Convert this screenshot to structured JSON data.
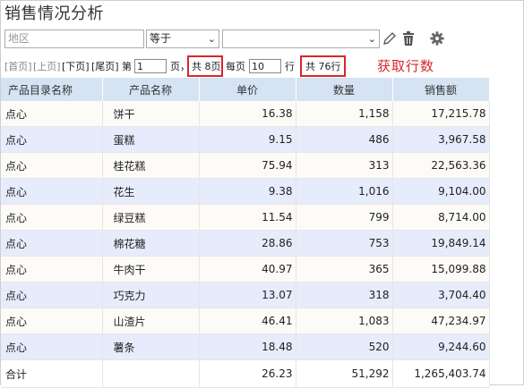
{
  "title": "销售情况分析",
  "filter": {
    "field_placeholder": "地区",
    "operator": "等于",
    "value": ""
  },
  "icons": {
    "edit": "pen-icon",
    "delete": "trash-icon",
    "settings": "gear-icon"
  },
  "pager": {
    "first": "[首页]",
    "prev": "[上页]",
    "next": "[下页]",
    "last": "[尾页]",
    "page_prefix": "第",
    "page_value": "1",
    "page_suffix": "页，",
    "total_pages": "共 8页",
    "per_page_label": "每页",
    "per_page_value": "10",
    "row_unit": "行",
    "total_rows": "共 76行"
  },
  "annotation": "获取行数",
  "colors": {
    "highlight": "#d9262c",
    "header_bg": "#d5e3f3",
    "row_alt": "#e6ecfb"
  },
  "table": {
    "headers": [
      "产品目录名称",
      "产品名称",
      "单价",
      "数量",
      "销售额"
    ],
    "rows": [
      [
        "点心",
        "饼干",
        "16.38",
        "1,158",
        "17,215.78"
      ],
      [
        "点心",
        "蛋糕",
        "9.15",
        "486",
        "3,967.58"
      ],
      [
        "点心",
        "桂花糕",
        "75.94",
        "313",
        "22,563.36"
      ],
      [
        "点心",
        "花生",
        "9.38",
        "1,016",
        "9,104.00"
      ],
      [
        "点心",
        "绿豆糕",
        "11.54",
        "799",
        "8,714.00"
      ],
      [
        "点心",
        "棉花糖",
        "28.86",
        "753",
        "19,849.14"
      ],
      [
        "点心",
        "牛肉干",
        "40.97",
        "365",
        "15,099.88"
      ],
      [
        "点心",
        "巧克力",
        "13.07",
        "318",
        "3,704.40"
      ],
      [
        "点心",
        "山渣片",
        "46.41",
        "1,083",
        "47,234.97"
      ],
      [
        "点心",
        "薯条",
        "18.48",
        "520",
        "9,244.60"
      ]
    ],
    "total": [
      "合计",
      "",
      "26.23",
      "51,292",
      "1,265,403.74"
    ]
  }
}
